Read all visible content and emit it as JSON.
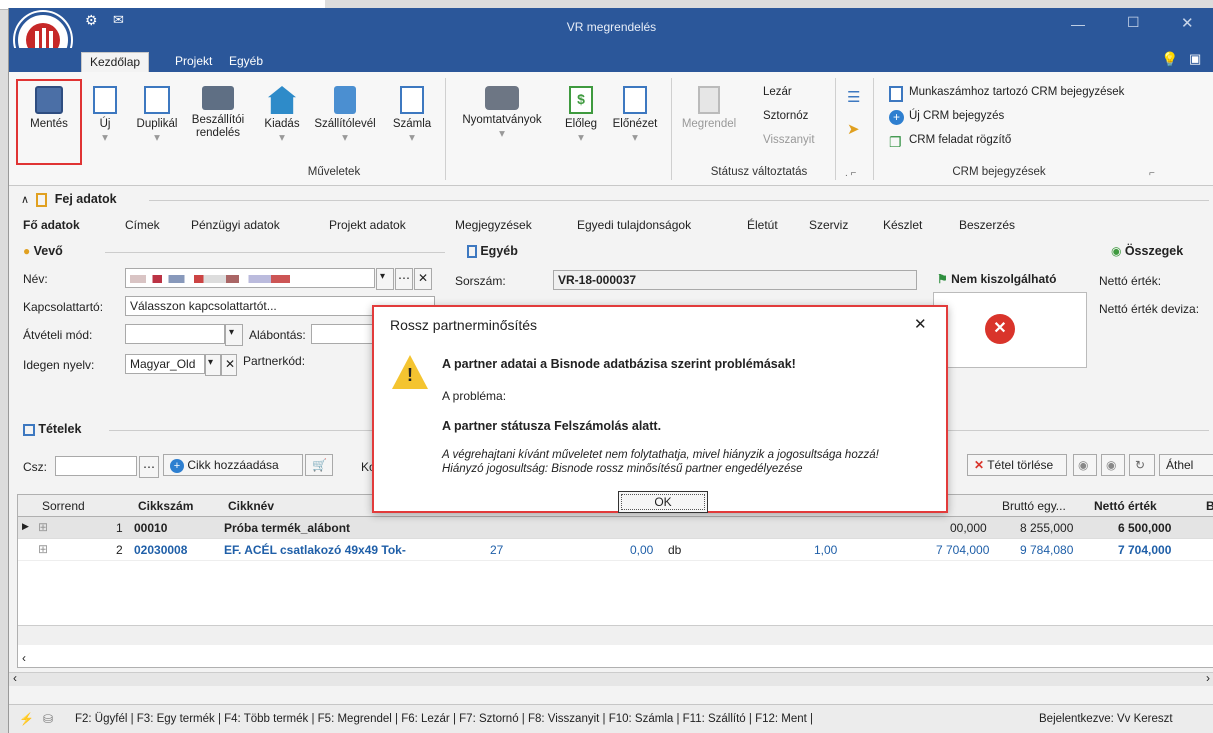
{
  "window": {
    "title": "VR megrendelés"
  },
  "ribbon_tabs": [
    "Kezdőlap",
    "Projekt",
    "Egyéb"
  ],
  "ribbon": {
    "buttons": [
      "Mentés",
      "Új",
      "Duplikál",
      "Beszállítói rendelés",
      "Kiadás",
      "Szállítólevél",
      "Számla",
      "Nyomtatványok",
      "Előleg",
      "Előnézet",
      "Megrendel"
    ],
    "status_items": [
      "Lezár",
      "Sztornóz",
      "Visszanyit"
    ],
    "crm_items": [
      "Munkaszámhoz tartozó CRM bejegyzések",
      "Új CRM bejegyzés",
      "CRM feladat rögzítő"
    ],
    "groups": [
      "Műveletek",
      "Státusz változtatás",
      "CRM bejegyzések"
    ]
  },
  "header": {
    "section_title": "Fej adatok",
    "tabs": [
      "Fő adatok",
      "Címek",
      "Pénzügyi adatok",
      "Projekt adatok",
      "Megjegyzések",
      "Egyedi tulajdonságok",
      "Életút",
      "Szerviz",
      "Készlet",
      "Beszerzés"
    ]
  },
  "vevo": {
    "title": "Vevő",
    "labels": [
      "Név:",
      "Kapcsolattartó:",
      "Átvételi mód:",
      "Idegen nyelv:"
    ],
    "kapcsolattarto_value": "Válasszon kapcsolattartót...",
    "alabontas_label": "Alábontás:",
    "idegen_nyelv_value": "Magyar_Old",
    "partnerkod_label": "Partnerkód:"
  },
  "egyeb": {
    "title": "Egyéb",
    "sorszam_label": "Sorszám:",
    "sorszam_value": "VR-18-000037",
    "nem_kiszolgalhato": "Nem kiszolgálható"
  },
  "osszegek": {
    "title": "Összegek",
    "netto": "Nettó érték:",
    "netto_deviza": "Nettó érték deviza:"
  },
  "tetelek": {
    "title": "Tételek",
    "csz_label": "Csz:",
    "add_button": "Cikk hozzáadása",
    "delete_button": "Tétel törlése",
    "move_button": "Áthel"
  },
  "grid": {
    "columns": [
      "Sorrend",
      "Cikkszám",
      "Cikknév",
      "Bruttó egy...",
      "Nettó érték",
      "B"
    ],
    "rows": [
      {
        "sorrend": "1",
        "cikkszam": "00010",
        "cikknev": "Próba termék_alábont",
        "col_partial": "00,000",
        "brutto_egy": "8 255,000",
        "netto": "6 500,000"
      },
      {
        "sorrend": "2",
        "cikkszam": "02030008",
        "cikknev": "EF. ACÉL csatlakozó 49x49 Tok-",
        "qty1": "27",
        "qty2": "0,00",
        "unit": "db",
        "qty3": "1,00",
        "col_partial": "7 704,000",
        "brutto_egy": "9 784,080",
        "netto": "7 704,000"
      }
    ]
  },
  "dialog": {
    "title": "Rossz partnerminősítés",
    "headline": "A partner adatai a Bisnode adatbázisa szerint problémásak!",
    "problem_label": "A probléma:",
    "problem": "A partner státusza Felszámolás alatt.",
    "detail_1": "A végrehajtani kívánt műveletet nem folytathatja, mivel hiányzik a jogosultsága hozzá!",
    "detail_2": "Hiányzó jogosultság: Bisnode rossz minősítésű partner engedélyezése",
    "ok": "OK"
  },
  "statusbar": {
    "shortcuts": "F2: Ügyfél | F3: Egy termék | F4: Több termék | F5: Megrendel | F6: Lezár | F7: Sztornó | F8: Visszanyit | F10: Számla | F11: Szállító | F12: Ment |",
    "user": "Bejelentkezve: Vv Kereszt"
  },
  "colors": {
    "titlebar": "#2b579a",
    "highlight": "#e03434",
    "link_blue": "#1f5fa8"
  }
}
